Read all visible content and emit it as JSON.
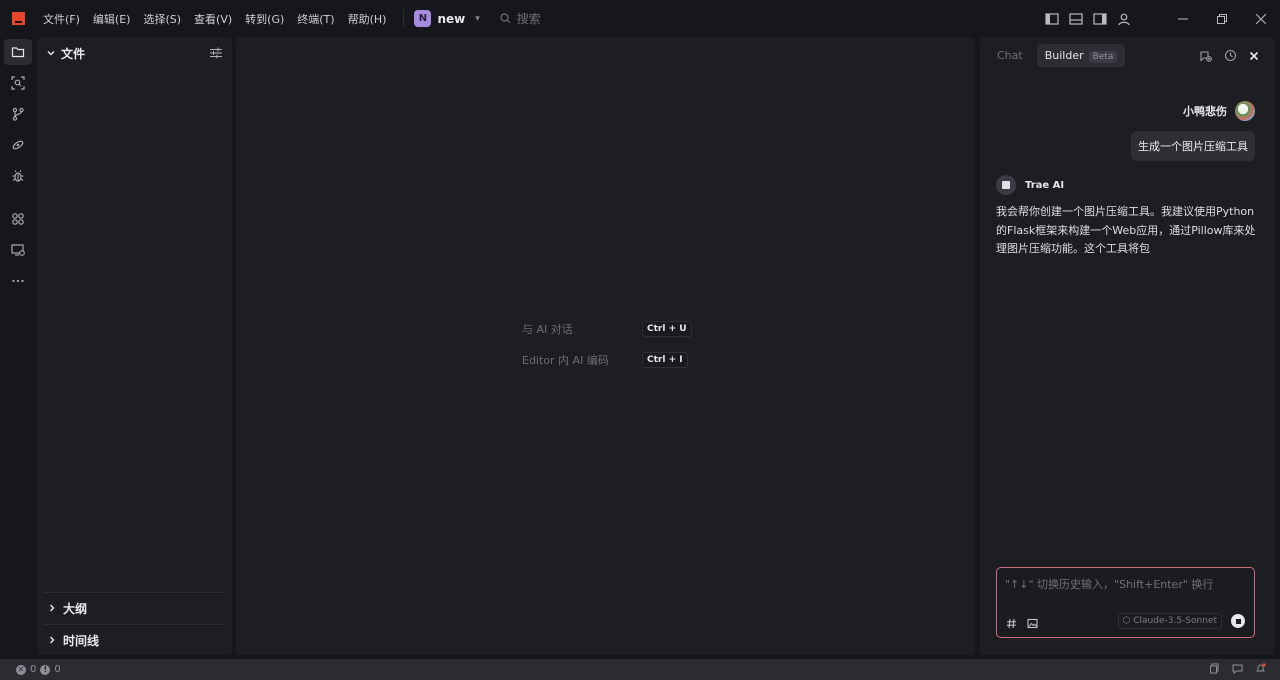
{
  "menu": [
    "文件(F)",
    "编辑(E)",
    "选择(S)",
    "查看(V)",
    "转到(G)",
    "终端(T)",
    "帮助(H)"
  ],
  "project": {
    "badge": "N",
    "name": "new"
  },
  "search": {
    "placeholder": "搜索"
  },
  "sidebar": {
    "title": "文件",
    "sections": [
      "大纲",
      "时间线"
    ]
  },
  "editor": {
    "hints": [
      {
        "label": "与 AI 对话",
        "key1": "Ctrl",
        "plus": "+",
        "key2": "U"
      },
      {
        "label": "Editor 内 AI 编码",
        "key1": "Ctrl",
        "plus": "+",
        "key2": "I"
      }
    ]
  },
  "chat": {
    "tabs": {
      "chat": "Chat",
      "builder": "Builder",
      "beta": "Beta"
    },
    "user": {
      "name": "小鸭悲伤",
      "message": "生成一个图片压缩工具"
    },
    "ai": {
      "name": "Trae AI",
      "message": "我会帮你创建一个图片压缩工具。我建议使用Python的Flask框架来构建一个Web应用，通过Pillow库来处理图片压缩功能。这个工具将包"
    },
    "input": {
      "placeholder": "\"↑↓\" 切换历史输入，\"Shift+Enter\" 换行",
      "model": "Claude-3.5-Sonnet"
    }
  },
  "status": {
    "errors": "0",
    "warnings": "0"
  },
  "colors": {
    "accent": "#e8462c",
    "input_border": "#d16a78",
    "project_badge": "#a78be0"
  }
}
